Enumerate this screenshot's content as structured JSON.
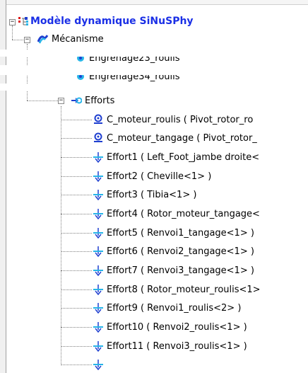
{
  "tree": {
    "root": {
      "label": "Modèle dynamique SiNuSPhy"
    },
    "mecanisme": {
      "label": "Mécanisme"
    },
    "truncated": [
      {
        "label": "Engrenage23_roulis"
      },
      {
        "label": "Engrenage34_roulis"
      }
    ],
    "efforts": {
      "label": "Efforts",
      "items": [
        {
          "label": "C_moteur_roulis ( Pivot_rotor_ro",
          "kind": "couple"
        },
        {
          "label": "C_moteur_tangage ( Pivot_rotor_",
          "kind": "couple"
        },
        {
          "label": "Effort1 ( Left_Foot_jambe droite<",
          "kind": "force"
        },
        {
          "label": "Effort2 ( Cheville<1> )",
          "kind": "force"
        },
        {
          "label": "Effort3 ( Tibia<1> )",
          "kind": "force"
        },
        {
          "label": "Effort4 ( Rotor_moteur_tangage<",
          "kind": "force"
        },
        {
          "label": "Effort5 ( Renvoi1_tangage<1> )",
          "kind": "force"
        },
        {
          "label": "Effort6 ( Renvoi2_tangage<1> )",
          "kind": "force"
        },
        {
          "label": "Effort7 ( Renvoi3_tangage<1> )",
          "kind": "force"
        },
        {
          "label": "Effort8 ( Rotor_moteur_roulis<1>",
          "kind": "force"
        },
        {
          "label": "Effort9 ( Renvoi1_roulis<2> )",
          "kind": "force"
        },
        {
          "label": "Effort10 ( Renvoi2_roulis<1> )",
          "kind": "force"
        },
        {
          "label": "Effort11 ( Renvoi3_roulis<1> )",
          "kind": "force"
        }
      ]
    }
  },
  "colors": {
    "root_text": "#1a2fe6",
    "icon_blue": "#1f3fd0",
    "icon_cyan": "#27b5e8"
  }
}
